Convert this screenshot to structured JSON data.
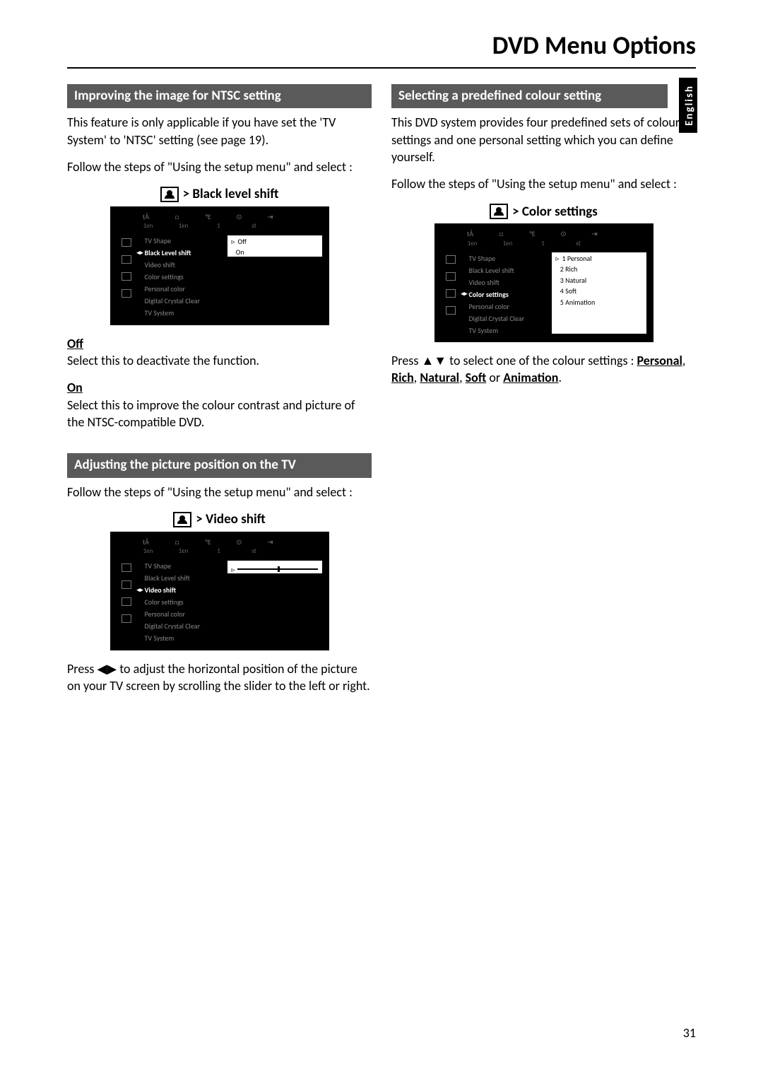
{
  "page_title": "DVD Menu Options",
  "page_number": "31",
  "language_tab": "English",
  "left_col": {
    "sec1": {
      "heading": "Improving the image for NTSC setting",
      "p1": "This feature is only applicable if you have set the 'TV System' to 'NTSC' setting (see page 19).",
      "p2": "Follow the steps of \"Using the setup menu\" and select :",
      "menu_caption": ">  Black level shift",
      "opt_off_name": "Off",
      "opt_off_desc": "Select this to deactivate the function.",
      "opt_on_name": "On",
      "opt_on_desc": "Select this to improve the colour contrast and picture of the NTSC-compatible DVD."
    },
    "sec2": {
      "heading": "Adjusting the picture position on the TV",
      "p1": "Follow the steps of \"Using the setup menu\" and select :",
      "menu_caption": ">  Video shift",
      "p2": "Press ◀▶ to adjust the horizontal position of the picture on your TV screen by scrolling the slider to the left or right."
    }
  },
  "right_col": {
    "sec1": {
      "heading": "Selecting a predefined colour setting",
      "p1": "This DVD system provides four predefined sets of colour settings and one personal setting which you can define yourself.",
      "p2": "Follow the steps of \"Using the setup menu\" and select :",
      "menu_caption": ">  Color settings",
      "p3_a": "Press ▲▼ to select one of the colour settings : ",
      "p3_b": "Personal",
      "p3_c": ", ",
      "p3_d": "Rich",
      "p3_e": ", ",
      "p3_f": "Natural",
      "p3_g": ", ",
      "p3_h": "Soft",
      "p3_i": " or ",
      "p3_j": "Animation",
      "p3_k": "."
    }
  },
  "osd": {
    "tabs": [
      "tÅ",
      "□",
      "°Ɛ",
      "⊙",
      "⇥"
    ],
    "subtabs": [
      "1en",
      "1en",
      "1",
      "st"
    ],
    "items": [
      "TV Shape",
      "Black Level shift",
      "Video shift",
      "Color settings",
      "Personal color",
      "Digital Crystal Clear",
      "TV System"
    ],
    "bls_vals": [
      "Off",
      "On"
    ],
    "cs_vals": [
      "1  Personal",
      "2  Rich",
      "3  Natural",
      "4  Soft",
      "5  Animation"
    ]
  }
}
